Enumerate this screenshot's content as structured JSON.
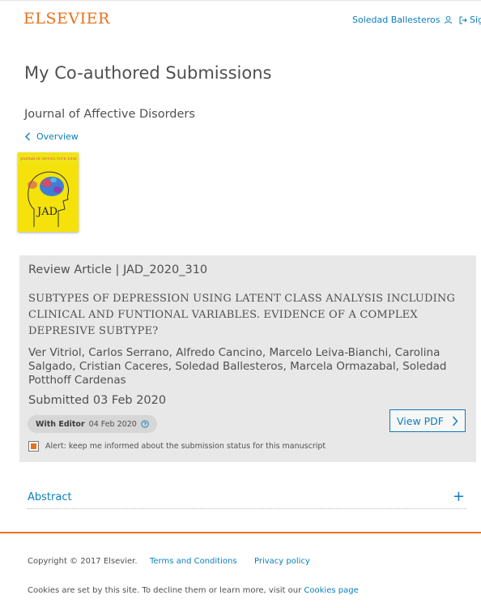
{
  "header": {
    "logo": "ELSEVIER",
    "user_name": "Soledad Ballesteros",
    "signout_label": "Sig"
  },
  "page": {
    "title": "My Co-authored Submissions",
    "journal": "Journal of Affective Disorders",
    "overview_link": "Overview"
  },
  "cover": {
    "journal_text": "Journal of AFFECTIVE DISORDERS",
    "logo_text": "JAD"
  },
  "article": {
    "type": "Review Article | JAD_2020_310",
    "title": "SUBTYPES OF DEPRESSION USING LATENT CLASS ANALYSIS INCLUDING CLINICAL AND FUNTIONAL VARIABLES. EVIDENCE OF A COMPLEX DEPRESIVE SUBTYPE?",
    "authors": "Ver Vitriol, Carlos Serrano, Alfredo Cancino, Marcelo Leiva-Bianchi, Carolina Salgado, Cristian Caceres, Soledad Ballesteros, Marcela Ormazabal, Soledad Potthoff Cardenas",
    "submitted": "Submitted 03 Feb 2020",
    "status_label": "With Editor",
    "status_date": "04 Feb 2020",
    "view_pdf_label": "View PDF",
    "alert_text": "Alert: keep me informed about the submission status for this manuscript",
    "alert_checked": true
  },
  "abstract": {
    "label": "Abstract",
    "toggle": "+"
  },
  "footer": {
    "copyright": "Copyright © 2017 Elsevier.",
    "terms": "Terms and Conditions",
    "privacy": "Privacy policy",
    "cookies_text": "Cookies are set by this site. To decline them or learn more, visit our",
    "cookies_link": "Cookies page"
  },
  "colors": {
    "brand_orange": "#e9711c",
    "link_blue": "#0c7dbb",
    "card_bg": "#e8e8e8"
  }
}
